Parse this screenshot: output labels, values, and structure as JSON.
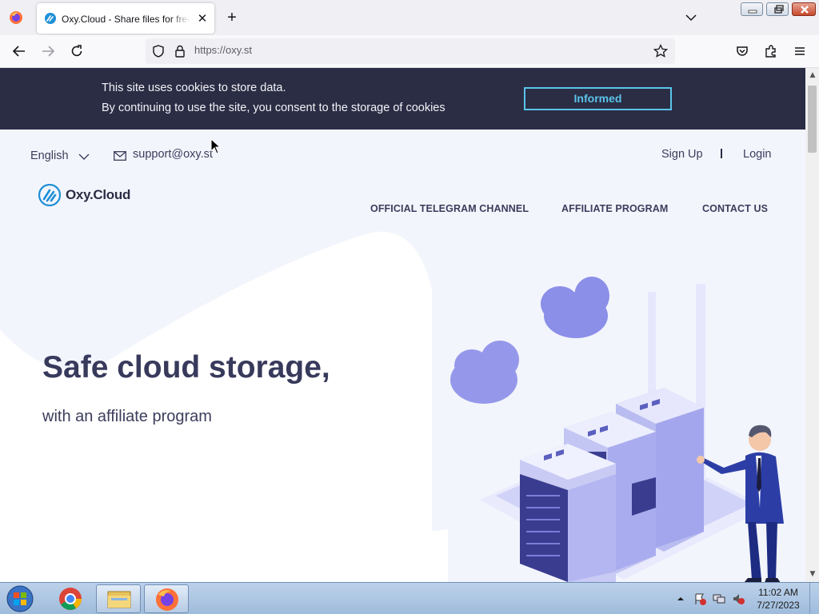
{
  "browser": {
    "tab_title": "Oxy.Cloud - Share files for free",
    "tab_close": "✕",
    "new_tab": "+",
    "url": "https://oxy.st"
  },
  "cookie_banner": {
    "line1": "This site uses cookies to store data.",
    "line2": "By continuing to use the site, you consent to the storage of cookies",
    "button": "Informed"
  },
  "header": {
    "language": "English",
    "support_email": "support@oxy.st",
    "sign_up": "Sign Up",
    "login": "Login",
    "logo_text": "Oxy.Cloud"
  },
  "menu": {
    "items": [
      {
        "label": "OFFICIAL TELEGRAM CHANNEL"
      },
      {
        "label": "AFFILIATE PROGRAM"
      },
      {
        "label": "CONTACT US"
      }
    ]
  },
  "hero": {
    "title": "Safe cloud storage,",
    "subtitle": "with an affiliate program"
  },
  "taskbar": {
    "time": "11:02 AM",
    "date": "7/27/2023"
  },
  "colors": {
    "banner_bg": "#2b2d45",
    "accent_cyan": "#5ac4e9",
    "page_bg": "#f3f5fd",
    "heading": "#383a5c",
    "illustration_purple": "#8b8fe8",
    "server_dark": "#3a3d8f"
  }
}
